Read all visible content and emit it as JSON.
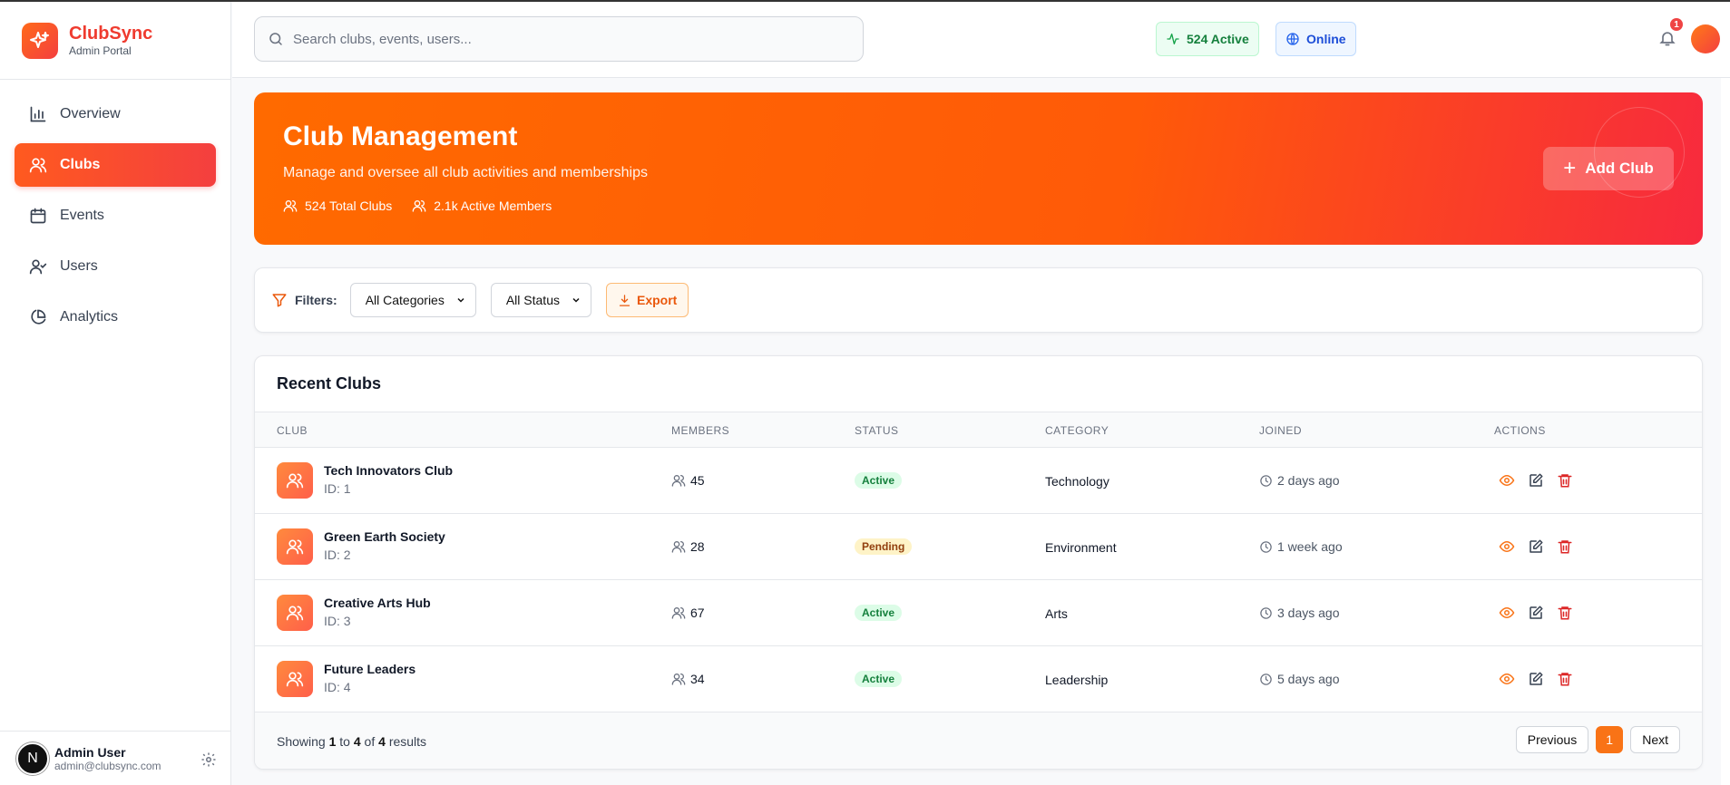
{
  "brand": {
    "name": "ClubSync",
    "subtitle": "Admin Portal"
  },
  "nav": [
    {
      "label": "Overview",
      "icon": "bar-chart-icon",
      "active": false
    },
    {
      "label": "Clubs",
      "icon": "users-icon",
      "active": true
    },
    {
      "label": "Events",
      "icon": "calendar-icon",
      "active": false
    },
    {
      "label": "Users",
      "icon": "user-check-icon",
      "active": false
    },
    {
      "label": "Analytics",
      "icon": "pie-chart-icon",
      "active": false
    }
  ],
  "user": {
    "initial": "N",
    "name": "Admin User",
    "email": "admin@clubsync.com"
  },
  "search": {
    "placeholder": "Search clubs, events, users..."
  },
  "status": {
    "active_label": "524 Active",
    "online_label": "Online"
  },
  "notifications": {
    "count": "1"
  },
  "hero": {
    "title": "Club Management",
    "subtitle": "Manage and oversee all club activities and memberships",
    "total_clubs": "524 Total Clubs",
    "active_members": "2.1k Active Members",
    "add_button": "Add Club"
  },
  "filters": {
    "label": "Filters:",
    "category_selected": "All Categories",
    "status_selected": "All Status",
    "export_label": "Export"
  },
  "table": {
    "title": "Recent Clubs",
    "columns": [
      "CLUB",
      "MEMBERS",
      "STATUS",
      "CATEGORY",
      "JOINED",
      "ACTIONS"
    ],
    "rows": [
      {
        "name": "Tech Innovators Club",
        "id": "ID: 1",
        "members": "45",
        "status": "Active",
        "category": "Technology",
        "joined": "2 days ago"
      },
      {
        "name": "Green Earth Society",
        "id": "ID: 2",
        "members": "28",
        "status": "Pending",
        "category": "Environment",
        "joined": "1 week ago"
      },
      {
        "name": "Creative Arts Hub",
        "id": "ID: 3",
        "members": "67",
        "status": "Active",
        "category": "Arts",
        "joined": "3 days ago"
      },
      {
        "name": "Future Leaders",
        "id": "ID: 4",
        "members": "34",
        "status": "Active",
        "category": "Leadership",
        "joined": "5 days ago"
      }
    ]
  },
  "pagination": {
    "showing_prefix": "Showing",
    "from": "1",
    "to_word": "to",
    "to": "4",
    "of_word": "of",
    "total": "4",
    "results_word": "results",
    "previous": "Previous",
    "current_page": "1",
    "next": "Next"
  },
  "colors": {
    "accent": "#f97316",
    "brand": "#ef3b2f",
    "danger": "#dc2626"
  }
}
